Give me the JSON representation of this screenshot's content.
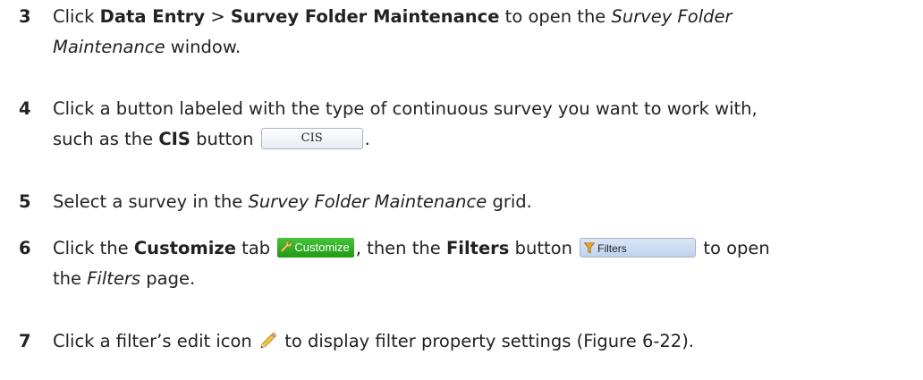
{
  "steps": [
    {
      "number": "3",
      "line1": {
        "t1": "Click ",
        "b1": "Data Entry",
        "t2": " > ",
        "b2": "Survey Folder Maintenance",
        "t3": " to open the ",
        "i1": "Survey Folder"
      },
      "line2": {
        "i1": "Maintenance",
        "t1": " window."
      }
    },
    {
      "number": "4",
      "line1": {
        "t1": "Click a button labeled with the type of continuous survey you want to work with,"
      },
      "line2": {
        "t1": "such as the ",
        "b1": "CIS",
        "t2": " button ",
        "button_label": "CIS",
        "t3": "."
      }
    },
    {
      "number": "5",
      "line1": {
        "t1": "Select a survey in the ",
        "i1": "Survey Folder Maintenance",
        "t2": " grid."
      }
    },
    {
      "number": "6",
      "line1": {
        "t1": "Click the ",
        "b1": "Customize",
        "t2": " tab ",
        "tab_label": "Customize",
        "t3": ", then the ",
        "b2": "Filters",
        "t4": " button ",
        "button_label": "Filters",
        "t5": " to open"
      },
      "line2": {
        "t1": "the ",
        "i1": "Filters",
        "t2": " page."
      }
    },
    {
      "number": "7",
      "line1": {
        "t1": "Click a filter’s edit icon ",
        "t2": " to display filter property settings (Figure 6-22)."
      }
    }
  ],
  "icons": {
    "customize_tab": "wrench-icon",
    "filters_button": "funnel-icon",
    "edit": "pencil-icon"
  },
  "colors": {
    "text": "#222222",
    "customize_tab_bg": "#2fae25",
    "filters_button_bg": "#c9daf1",
    "cis_button_bg": "#eef3f8"
  }
}
